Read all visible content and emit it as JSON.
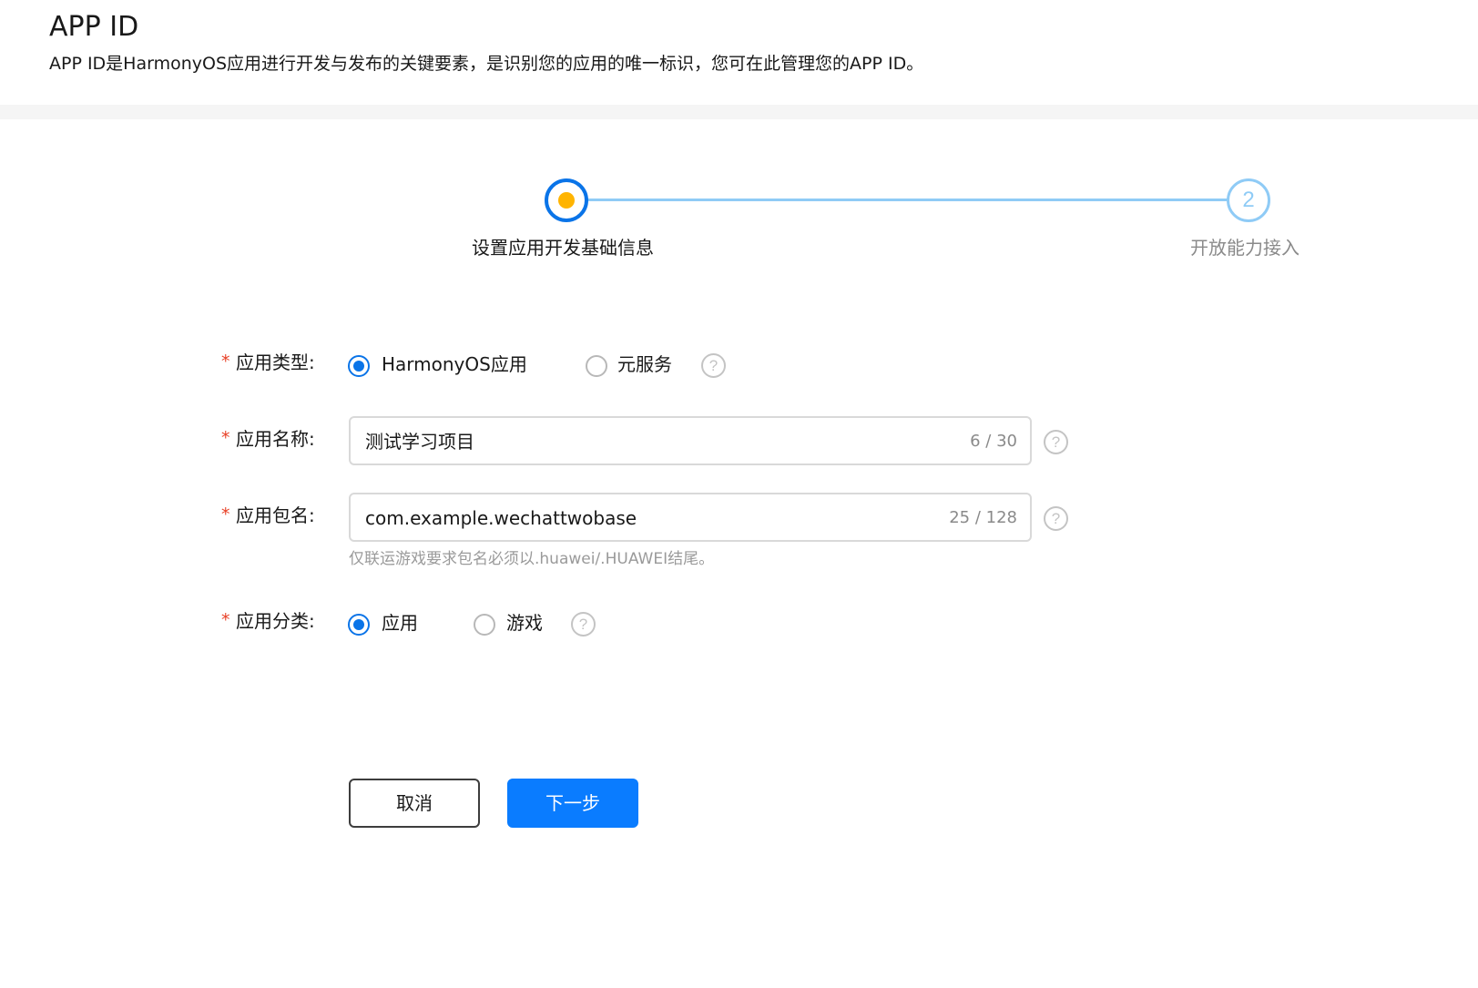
{
  "header": {
    "title": "APP ID",
    "description": "APP ID是HarmonyOS应用进行开发与发布的关键要素，是识别您的应用的唯一标识，您可在此管理您的APP ID。"
  },
  "steps": [
    {
      "label": "设置应用开发基础信息",
      "status": "active"
    },
    {
      "number": "2",
      "label": "开放能力接入",
      "status": "pending"
    }
  ],
  "form": {
    "required_mark": "*",
    "app_type": {
      "label": "应用类型:",
      "options": [
        {
          "label": "HarmonyOS应用",
          "checked": true
        },
        {
          "label": "元服务",
          "checked": false
        }
      ],
      "help": "?"
    },
    "app_name": {
      "label": "应用名称:",
      "value": "测试学习项目",
      "count": "6 / 30",
      "help": "?"
    },
    "package_name": {
      "label": "应用包名:",
      "value": "com.example.wechattwobase",
      "count": "25 / 128",
      "hint": "仅联运游戏要求包名必须以.huawei/.HUAWEI结尾。",
      "help": "?"
    },
    "app_category": {
      "label": "应用分类:",
      "options": [
        {
          "label": "应用",
          "checked": true
        },
        {
          "label": "游戏",
          "checked": false
        }
      ],
      "help": "?"
    }
  },
  "buttons": {
    "cancel": "取消",
    "next": "下一步"
  },
  "colors": {
    "primary": "#0a7cff",
    "step_active_dot": "#ffb400",
    "step_line": "#8fcbf6",
    "required": "#e84026"
  }
}
